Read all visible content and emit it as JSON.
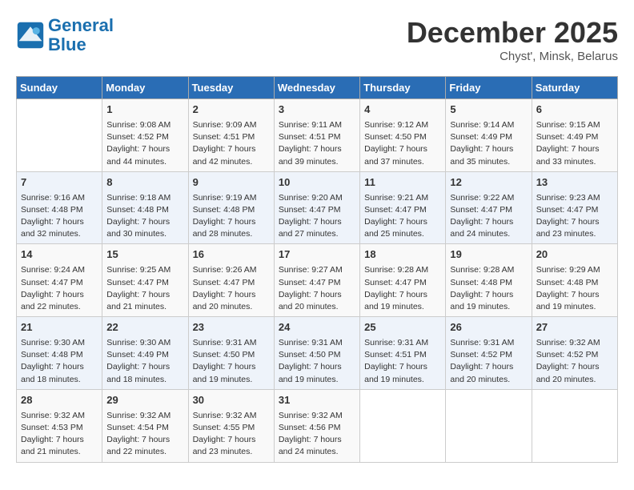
{
  "header": {
    "logo_line1": "General",
    "logo_line2": "Blue",
    "month": "December 2025",
    "location": "Chyst', Minsk, Belarus"
  },
  "days_of_week": [
    "Sunday",
    "Monday",
    "Tuesday",
    "Wednesday",
    "Thursday",
    "Friday",
    "Saturday"
  ],
  "weeks": [
    [
      {
        "day": "",
        "sunrise": "",
        "sunset": "",
        "daylight": ""
      },
      {
        "day": "1",
        "sunrise": "Sunrise: 9:08 AM",
        "sunset": "Sunset: 4:52 PM",
        "daylight": "Daylight: 7 hours and 44 minutes."
      },
      {
        "day": "2",
        "sunrise": "Sunrise: 9:09 AM",
        "sunset": "Sunset: 4:51 PM",
        "daylight": "Daylight: 7 hours and 42 minutes."
      },
      {
        "day": "3",
        "sunrise": "Sunrise: 9:11 AM",
        "sunset": "Sunset: 4:51 PM",
        "daylight": "Daylight: 7 hours and 39 minutes."
      },
      {
        "day": "4",
        "sunrise": "Sunrise: 9:12 AM",
        "sunset": "Sunset: 4:50 PM",
        "daylight": "Daylight: 7 hours and 37 minutes."
      },
      {
        "day": "5",
        "sunrise": "Sunrise: 9:14 AM",
        "sunset": "Sunset: 4:49 PM",
        "daylight": "Daylight: 7 hours and 35 minutes."
      },
      {
        "day": "6",
        "sunrise": "Sunrise: 9:15 AM",
        "sunset": "Sunset: 4:49 PM",
        "daylight": "Daylight: 7 hours and 33 minutes."
      }
    ],
    [
      {
        "day": "7",
        "sunrise": "Sunrise: 9:16 AM",
        "sunset": "Sunset: 4:48 PM",
        "daylight": "Daylight: 7 hours and 32 minutes."
      },
      {
        "day": "8",
        "sunrise": "Sunrise: 9:18 AM",
        "sunset": "Sunset: 4:48 PM",
        "daylight": "Daylight: 7 hours and 30 minutes."
      },
      {
        "day": "9",
        "sunrise": "Sunrise: 9:19 AM",
        "sunset": "Sunset: 4:48 PM",
        "daylight": "Daylight: 7 hours and 28 minutes."
      },
      {
        "day": "10",
        "sunrise": "Sunrise: 9:20 AM",
        "sunset": "Sunset: 4:47 PM",
        "daylight": "Daylight: 7 hours and 27 minutes."
      },
      {
        "day": "11",
        "sunrise": "Sunrise: 9:21 AM",
        "sunset": "Sunset: 4:47 PM",
        "daylight": "Daylight: 7 hours and 25 minutes."
      },
      {
        "day": "12",
        "sunrise": "Sunrise: 9:22 AM",
        "sunset": "Sunset: 4:47 PM",
        "daylight": "Daylight: 7 hours and 24 minutes."
      },
      {
        "day": "13",
        "sunrise": "Sunrise: 9:23 AM",
        "sunset": "Sunset: 4:47 PM",
        "daylight": "Daylight: 7 hours and 23 minutes."
      }
    ],
    [
      {
        "day": "14",
        "sunrise": "Sunrise: 9:24 AM",
        "sunset": "Sunset: 4:47 PM",
        "daylight": "Daylight: 7 hours and 22 minutes."
      },
      {
        "day": "15",
        "sunrise": "Sunrise: 9:25 AM",
        "sunset": "Sunset: 4:47 PM",
        "daylight": "Daylight: 7 hours and 21 minutes."
      },
      {
        "day": "16",
        "sunrise": "Sunrise: 9:26 AM",
        "sunset": "Sunset: 4:47 PM",
        "daylight": "Daylight: 7 hours and 20 minutes."
      },
      {
        "day": "17",
        "sunrise": "Sunrise: 9:27 AM",
        "sunset": "Sunset: 4:47 PM",
        "daylight": "Daylight: 7 hours and 20 minutes."
      },
      {
        "day": "18",
        "sunrise": "Sunrise: 9:28 AM",
        "sunset": "Sunset: 4:47 PM",
        "daylight": "Daylight: 7 hours and 19 minutes."
      },
      {
        "day": "19",
        "sunrise": "Sunrise: 9:28 AM",
        "sunset": "Sunset: 4:48 PM",
        "daylight": "Daylight: 7 hours and 19 minutes."
      },
      {
        "day": "20",
        "sunrise": "Sunrise: 9:29 AM",
        "sunset": "Sunset: 4:48 PM",
        "daylight": "Daylight: 7 hours and 19 minutes."
      }
    ],
    [
      {
        "day": "21",
        "sunrise": "Sunrise: 9:30 AM",
        "sunset": "Sunset: 4:48 PM",
        "daylight": "Daylight: 7 hours and 18 minutes."
      },
      {
        "day": "22",
        "sunrise": "Sunrise: 9:30 AM",
        "sunset": "Sunset: 4:49 PM",
        "daylight": "Daylight: 7 hours and 18 minutes."
      },
      {
        "day": "23",
        "sunrise": "Sunrise: 9:31 AM",
        "sunset": "Sunset: 4:50 PM",
        "daylight": "Daylight: 7 hours and 19 minutes."
      },
      {
        "day": "24",
        "sunrise": "Sunrise: 9:31 AM",
        "sunset": "Sunset: 4:50 PM",
        "daylight": "Daylight: 7 hours and 19 minutes."
      },
      {
        "day": "25",
        "sunrise": "Sunrise: 9:31 AM",
        "sunset": "Sunset: 4:51 PM",
        "daylight": "Daylight: 7 hours and 19 minutes."
      },
      {
        "day": "26",
        "sunrise": "Sunrise: 9:31 AM",
        "sunset": "Sunset: 4:52 PM",
        "daylight": "Daylight: 7 hours and 20 minutes."
      },
      {
        "day": "27",
        "sunrise": "Sunrise: 9:32 AM",
        "sunset": "Sunset: 4:52 PM",
        "daylight": "Daylight: 7 hours and 20 minutes."
      }
    ],
    [
      {
        "day": "28",
        "sunrise": "Sunrise: 9:32 AM",
        "sunset": "Sunset: 4:53 PM",
        "daylight": "Daylight: 7 hours and 21 minutes."
      },
      {
        "day": "29",
        "sunrise": "Sunrise: 9:32 AM",
        "sunset": "Sunset: 4:54 PM",
        "daylight": "Daylight: 7 hours and 22 minutes."
      },
      {
        "day": "30",
        "sunrise": "Sunrise: 9:32 AM",
        "sunset": "Sunset: 4:55 PM",
        "daylight": "Daylight: 7 hours and 23 minutes."
      },
      {
        "day": "31",
        "sunrise": "Sunrise: 9:32 AM",
        "sunset": "Sunset: 4:56 PM",
        "daylight": "Daylight: 7 hours and 24 minutes."
      },
      {
        "day": "",
        "sunrise": "",
        "sunset": "",
        "daylight": ""
      },
      {
        "day": "",
        "sunrise": "",
        "sunset": "",
        "daylight": ""
      },
      {
        "day": "",
        "sunrise": "",
        "sunset": "",
        "daylight": ""
      }
    ]
  ]
}
